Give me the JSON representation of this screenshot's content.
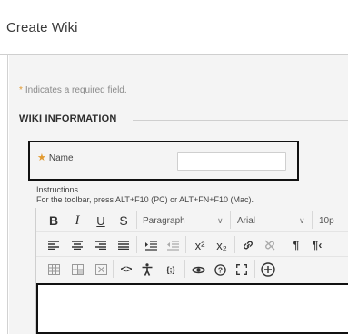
{
  "page": {
    "title": "Create Wiki"
  },
  "form": {
    "required_note_star": "*",
    "required_note": "Indicates a required field.",
    "section_title": "WIKI INFORMATION",
    "name_star": "★",
    "name_label": "Name",
    "name_value": "",
    "instructions_label": "Instructions",
    "toolbar_help": "For the toolbar, press ALT+F10 (PC) or ALT+FN+F10 (Mac)."
  },
  "toolbar": {
    "row1": {
      "bold": "B",
      "italic": "I",
      "underline": "U",
      "strike": "S",
      "paragraph": "Paragraph",
      "font": "Arial",
      "size": "10p"
    },
    "row2": {
      "superscript": "x²",
      "subscript": "x₂",
      "ltr": "¶",
      "rtl": "¶‹"
    },
    "row3": {
      "code": "<>",
      "variable": "{;}"
    }
  },
  "icons": [
    "bold-icon",
    "italic-icon",
    "underline-icon",
    "strikethrough-icon",
    "align-left-icon",
    "align-center-icon",
    "align-right-icon",
    "justify-icon",
    "indent-icon",
    "outdent-icon",
    "link-icon",
    "unlink-icon",
    "table-icon",
    "table-cell-icon",
    "clear-table-icon",
    "source-code-icon",
    "accessibility-icon",
    "math-icon",
    "preview-icon",
    "help-icon",
    "fullscreen-icon",
    "add-content-icon"
  ],
  "colors": {
    "required_star": "#e29a30",
    "highlight_border": "#111111",
    "panel_bg": "#f4f4f4"
  }
}
